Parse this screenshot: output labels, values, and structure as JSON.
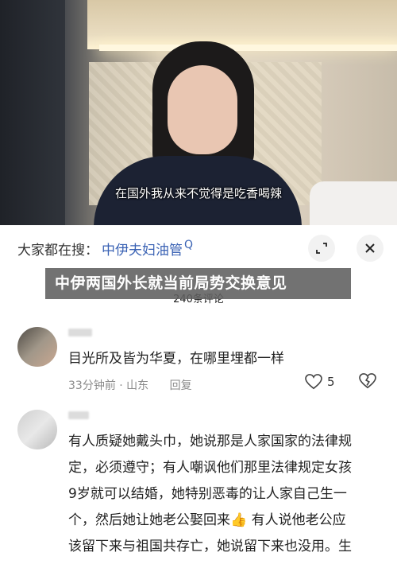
{
  "video": {
    "subtitle": "在国外我从来不觉得是吃香喝辣"
  },
  "search": {
    "prefix": "大家都在搜：",
    "term": "中伊夫妇油管",
    "icon_glyph": "Q"
  },
  "headline": "中伊两国外长就当前局势交换意见",
  "comments_header": {
    "count_label": "240条评论"
  },
  "comments": [
    {
      "text": "目光所及皆为华夏，在哪里埋都一样",
      "time": "33分钟前 · 山东",
      "reply_label": "回复",
      "likes": "5"
    },
    {
      "lines": [
        "有人质疑她戴头巾，她说那是人家国家的法律规",
        "定，必须遵守；有人嘲讽他们那里法律规定女孩",
        "9岁就可以结婚，她特别恶毒的让人家自己生一",
        "个，然后她让她老公娶回来👍 有人说他老公应",
        "该留下来与祖国共存亡，她说留下来也没用。生"
      ]
    }
  ],
  "icons": {
    "expand": "expand-icon",
    "close": "close-icon",
    "heart": "heart-icon",
    "dislike": "dislike-icon"
  }
}
